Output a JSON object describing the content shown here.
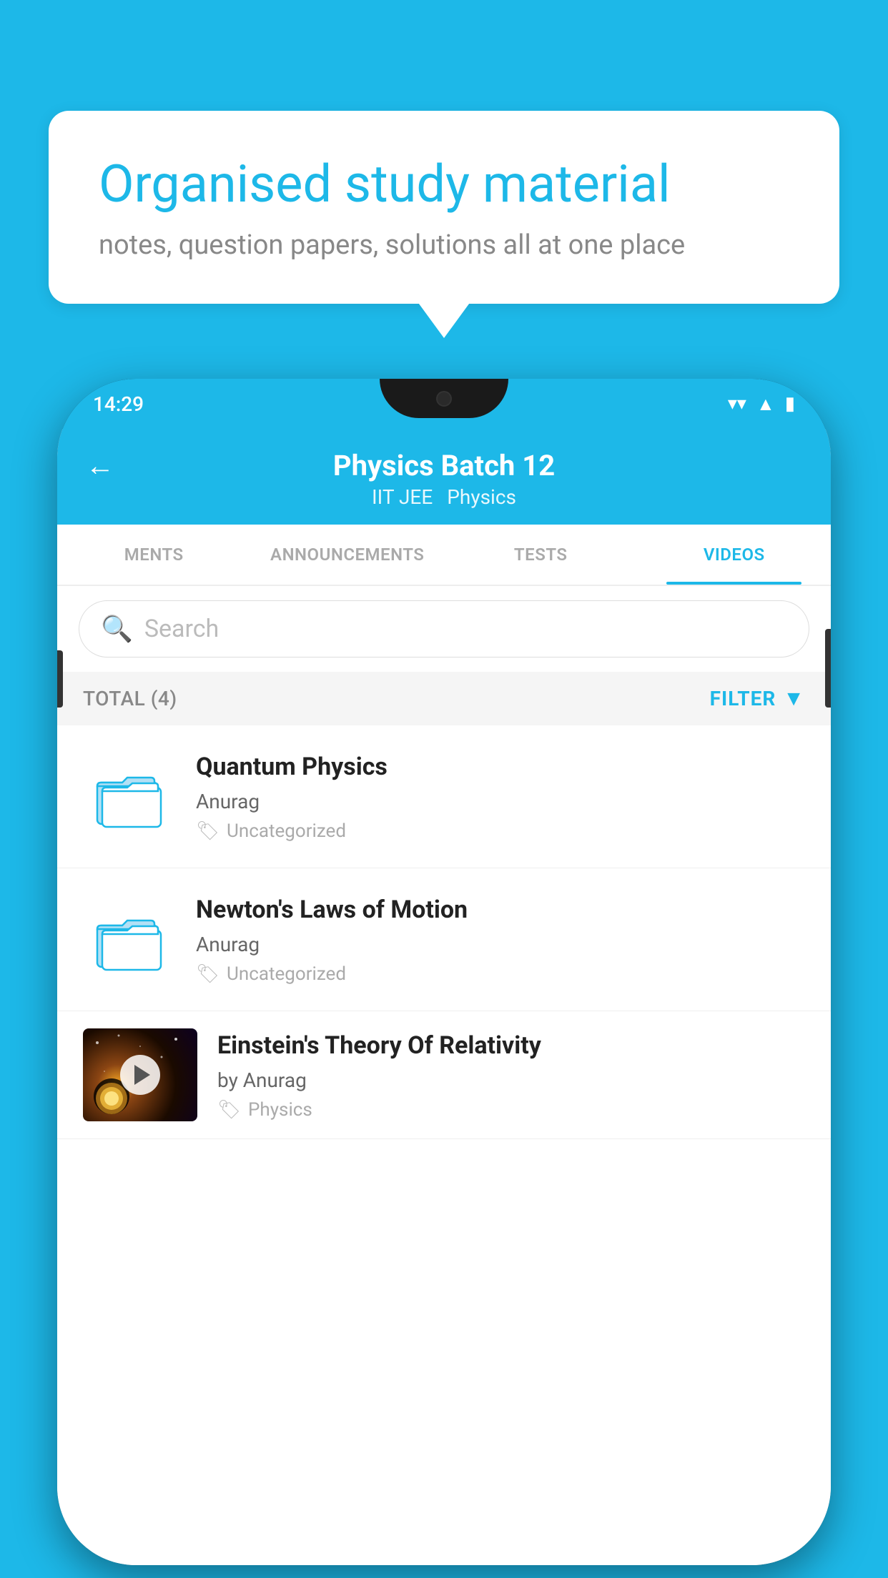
{
  "background_color": "#1db8e8",
  "bubble": {
    "title": "Organised study material",
    "subtitle": "notes, question papers, solutions all at one place"
  },
  "status_bar": {
    "time": "14:29",
    "icons": [
      "wifi",
      "signal",
      "battery"
    ]
  },
  "header": {
    "back_label": "←",
    "title": "Physics Batch 12",
    "subtitle_left": "IIT JEE",
    "subtitle_right": "Physics"
  },
  "tabs": [
    {
      "label": "MENTS",
      "active": false
    },
    {
      "label": "ANNOUNCEMENTS",
      "active": false
    },
    {
      "label": "TESTS",
      "active": false
    },
    {
      "label": "VIDEOS",
      "active": true
    }
  ],
  "search": {
    "placeholder": "Search"
  },
  "filter": {
    "total_label": "TOTAL (4)",
    "filter_label": "FILTER"
  },
  "videos": [
    {
      "id": 1,
      "title": "Quantum Physics",
      "author": "Anurag",
      "tag": "Uncategorized",
      "has_thumbnail": false
    },
    {
      "id": 2,
      "title": "Newton's Laws of Motion",
      "author": "Anurag",
      "tag": "Uncategorized",
      "has_thumbnail": false
    },
    {
      "id": 3,
      "title": "Einstein's Theory Of Relativity",
      "author": "by Anurag",
      "tag": "Physics",
      "has_thumbnail": true
    }
  ]
}
